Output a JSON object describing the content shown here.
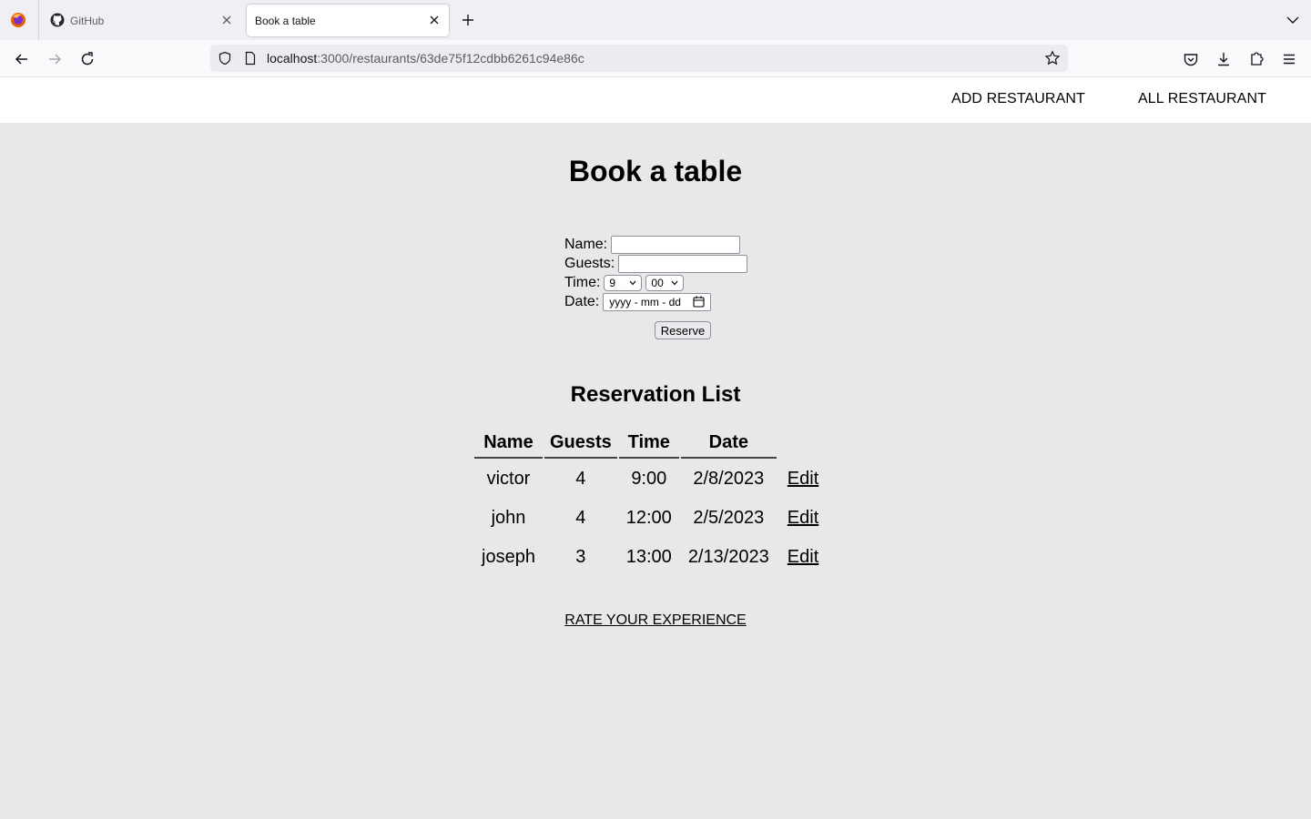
{
  "browser": {
    "tabs": [
      {
        "title": "GitHub"
      },
      {
        "title": "Book a table"
      }
    ],
    "url": {
      "host": "localhost",
      "path": ":3000/restaurants/63de75f12cdbb6261c94e86c"
    }
  },
  "nav": {
    "add_restaurant": "ADD RESTAURANT",
    "all_restaurant": "ALL RESTAURANT"
  },
  "page_title": "Book a table",
  "form": {
    "name_label": "Name:",
    "name_value": "",
    "guests_label": "Guests:",
    "guests_value": "",
    "time_label": "Time:",
    "time_hour": "9",
    "time_minute": "00",
    "date_label": "Date:",
    "date_placeholder": "yyyy - mm - dd",
    "reserve_label": "Reserve"
  },
  "reservation_list": {
    "title": "Reservation List",
    "headers": [
      "Name",
      "Guests",
      "Time",
      "Date"
    ],
    "rows": [
      {
        "name": "victor",
        "guests": "4",
        "time": "9:00",
        "date": "2/8/2023",
        "action": "Edit"
      },
      {
        "name": "john",
        "guests": "4",
        "time": "12:00",
        "date": "2/5/2023",
        "action": "Edit"
      },
      {
        "name": "joseph",
        "guests": "3",
        "time": "13:00",
        "date": "2/13/2023",
        "action": "Edit"
      }
    ]
  },
  "rate_link": "RATE YOUR EXPERIENCE"
}
